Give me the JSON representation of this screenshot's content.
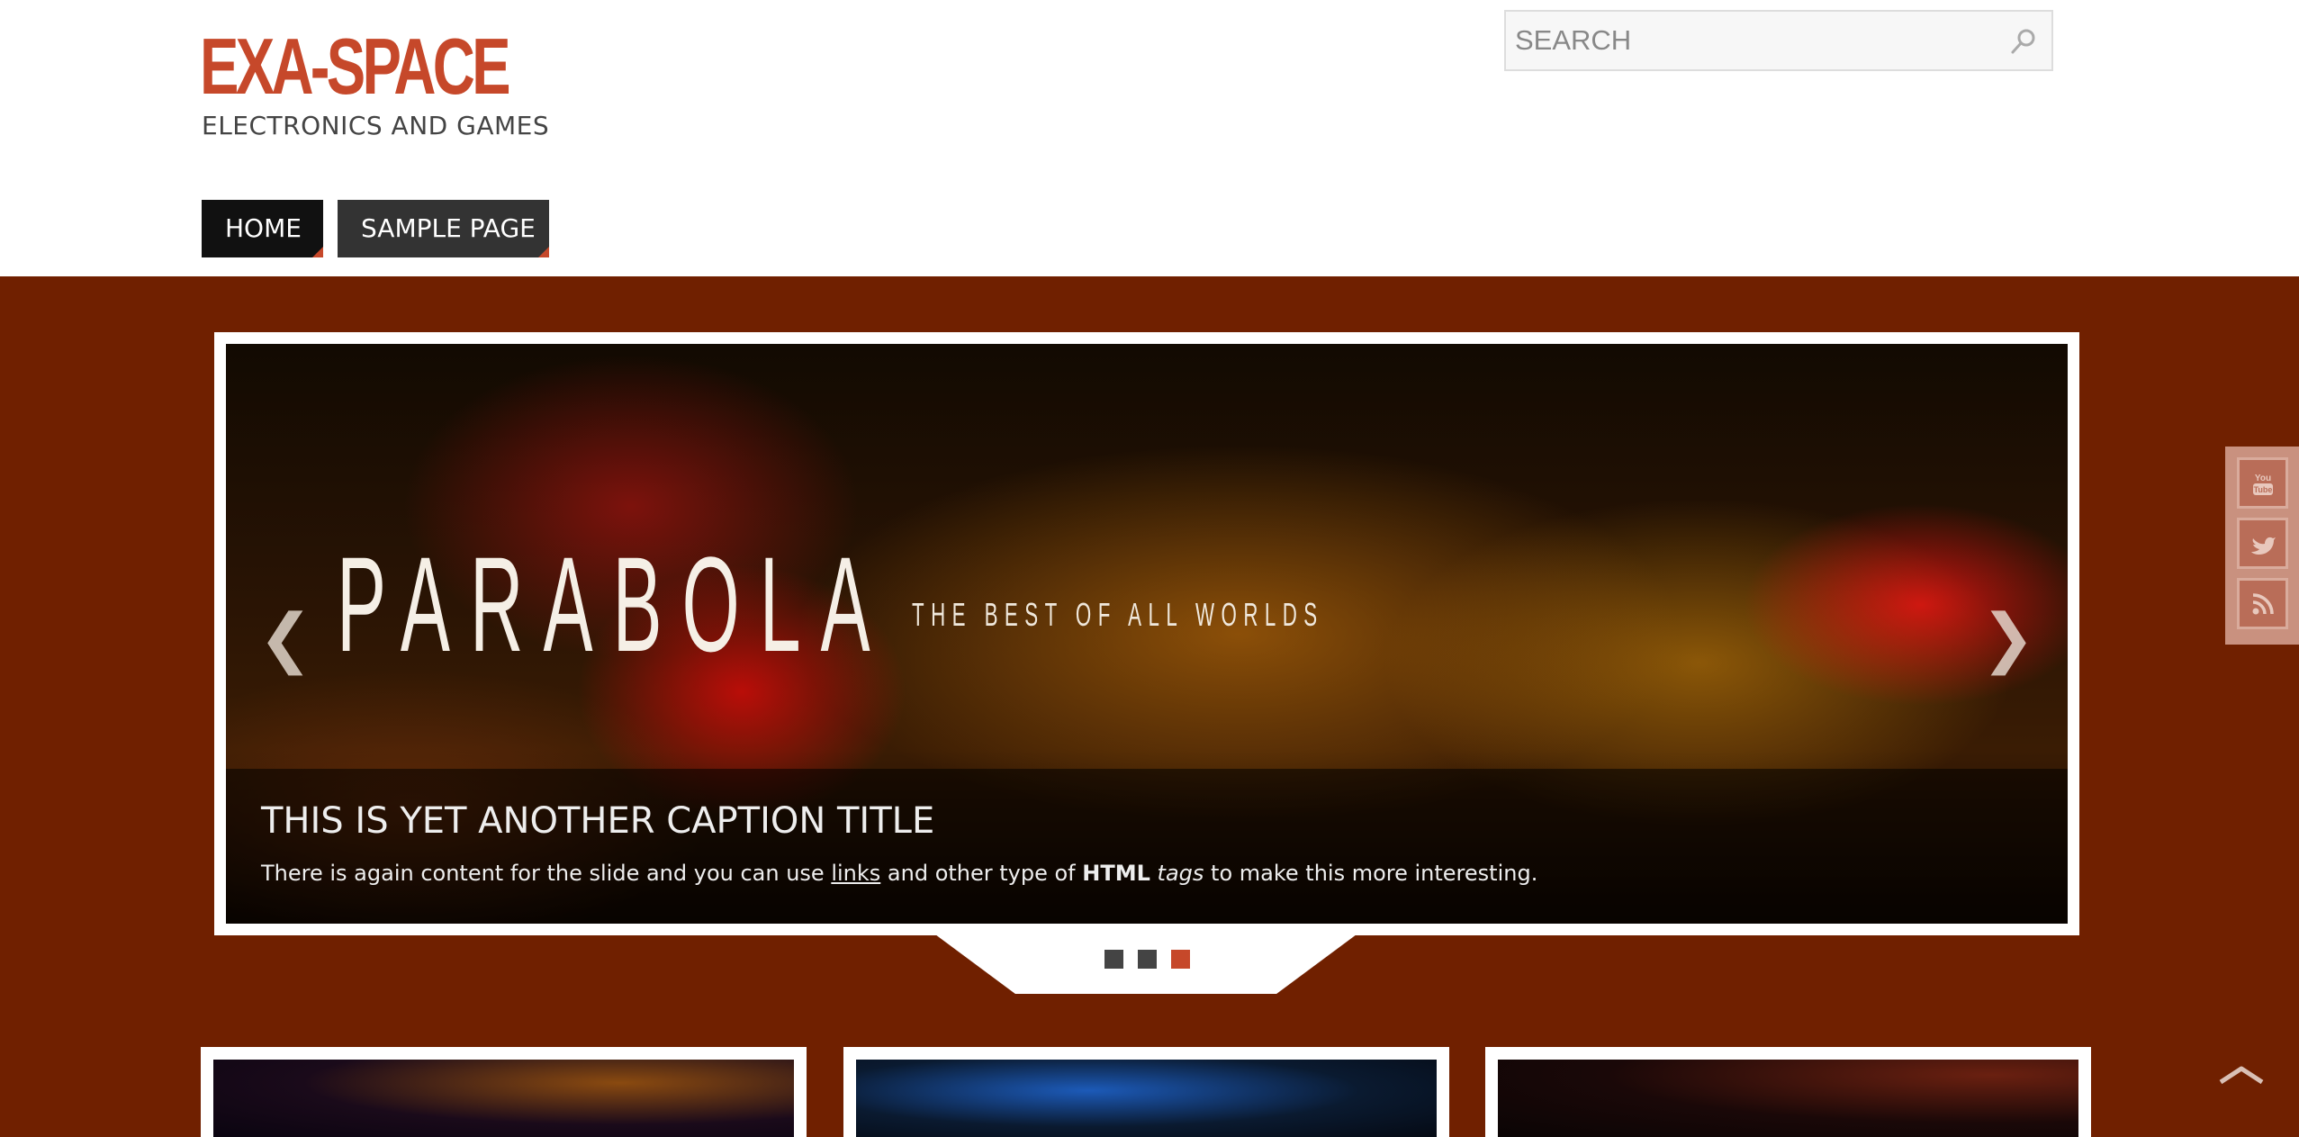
{
  "site": {
    "title": "EXA-SPACE",
    "tagline": "ELECTRONICS AND GAMES"
  },
  "search": {
    "placeholder": "SEARCH",
    "icon": "search-icon"
  },
  "nav": {
    "items": [
      {
        "label": "HOME",
        "active": true
      },
      {
        "label": "SAMPLE PAGE",
        "active": false
      }
    ]
  },
  "slider": {
    "image_title": "PARABOLA",
    "image_subtitle": "THE BEST OF ALL WORLDS",
    "prev_arrow": "❮",
    "next_arrow": "❯",
    "caption": {
      "title": "THIS IS YET ANOTHER CAPTION TITLE",
      "text_before_link": "There is again content for the slide and you can use ",
      "link": "links",
      "text_after_link": " and other type of ",
      "bold": "HTML",
      "italic": "tags",
      "text_end": " to make this more interesting."
    },
    "pager": {
      "count": 3,
      "active": 3
    }
  },
  "social": {
    "items": [
      "youtube-icon",
      "twitter-icon",
      "rss-icon"
    ]
  },
  "colors": {
    "accent": "#c6482a",
    "background": "#702000",
    "nav_active": "#111111",
    "nav": "#333333"
  }
}
